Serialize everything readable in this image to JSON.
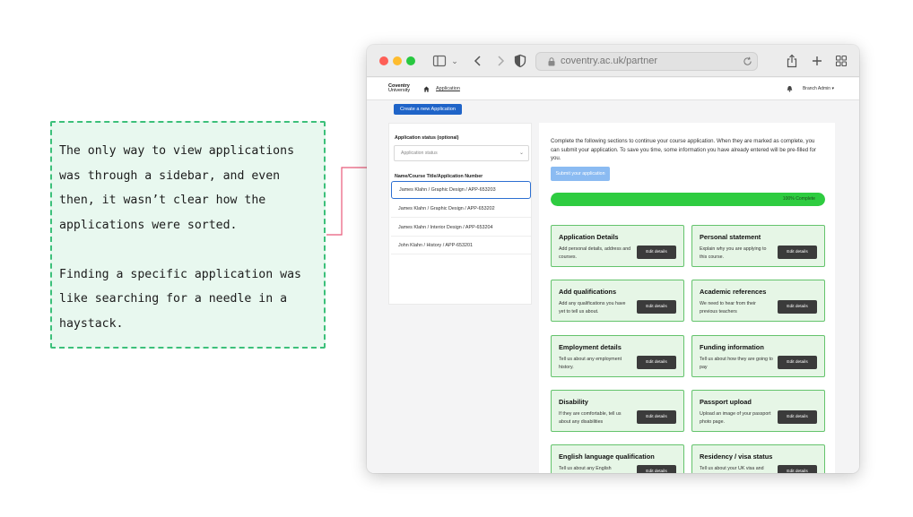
{
  "note": {
    "paragraph1": "The only way to view applications was through a sidebar, and even then, it wasn’t clear how the applications were sorted.",
    "paragraph2": "Finding a specific application was like searching for a needle in a haystack."
  },
  "browser": {
    "url": "coventry.ac.uk/partner"
  },
  "nav": {
    "logo_line1": "Coventry",
    "logo_line2": "University",
    "breadcrumb": "Application",
    "user": "Branch Admin"
  },
  "create_button": "Create a new Application",
  "sidebar": {
    "status_label": "Application status (optional)",
    "status_placeholder": "Application status",
    "list_label": "Name/Course Title/Application Number",
    "items": [
      {
        "label": "James Klahn / Graphic Design / APP-653203"
      },
      {
        "label": "James Klahn / Graphic Design / APP-653202"
      },
      {
        "label": "James Klahn / Interior Design / APP-653204"
      },
      {
        "label": "John Klahn / History / APP-653201"
      }
    ]
  },
  "main": {
    "intro": "Complete the following sections to continue your course application. When they are marked as complete, you can submit your application. To save you time, some information you have already entered will be pre-filled for you.",
    "submit_label": "Submit your application",
    "progress_value": 1.0,
    "progress_label": "100% Complete",
    "edit_label": "Edit details",
    "cards": [
      {
        "title": "Application Details",
        "desc": "Add personal details, address and courses."
      },
      {
        "title": "Personal statement",
        "desc": "Explain why you are applying to this course."
      },
      {
        "title": "Add qualifications",
        "desc": "Add any qualifications you have yet to tell us about."
      },
      {
        "title": "Academic references",
        "desc": "We need to hear from their previous teachers"
      },
      {
        "title": "Employment details",
        "desc": "Tell us about any employment history."
      },
      {
        "title": "Funding information",
        "desc": "Tell us about how they are going to pay"
      },
      {
        "title": "Disability",
        "desc": "If they are comfortable, tell us about any disabilities"
      },
      {
        "title": "Passport upload",
        "desc": "Upload an image of your passport photo page."
      },
      {
        "title": "English language qualification",
        "desc": "Tell us about any English"
      },
      {
        "title": "Residency / visa status",
        "desc": "Tell us about your UK visa and"
      }
    ]
  },
  "colors": {
    "note_border": "#3cc07a",
    "connector": "#e85a7a",
    "primary": "#1f64c8",
    "progress": "#2ecc40",
    "card_bg": "#e6f6e6",
    "card_border": "#64c36c"
  }
}
